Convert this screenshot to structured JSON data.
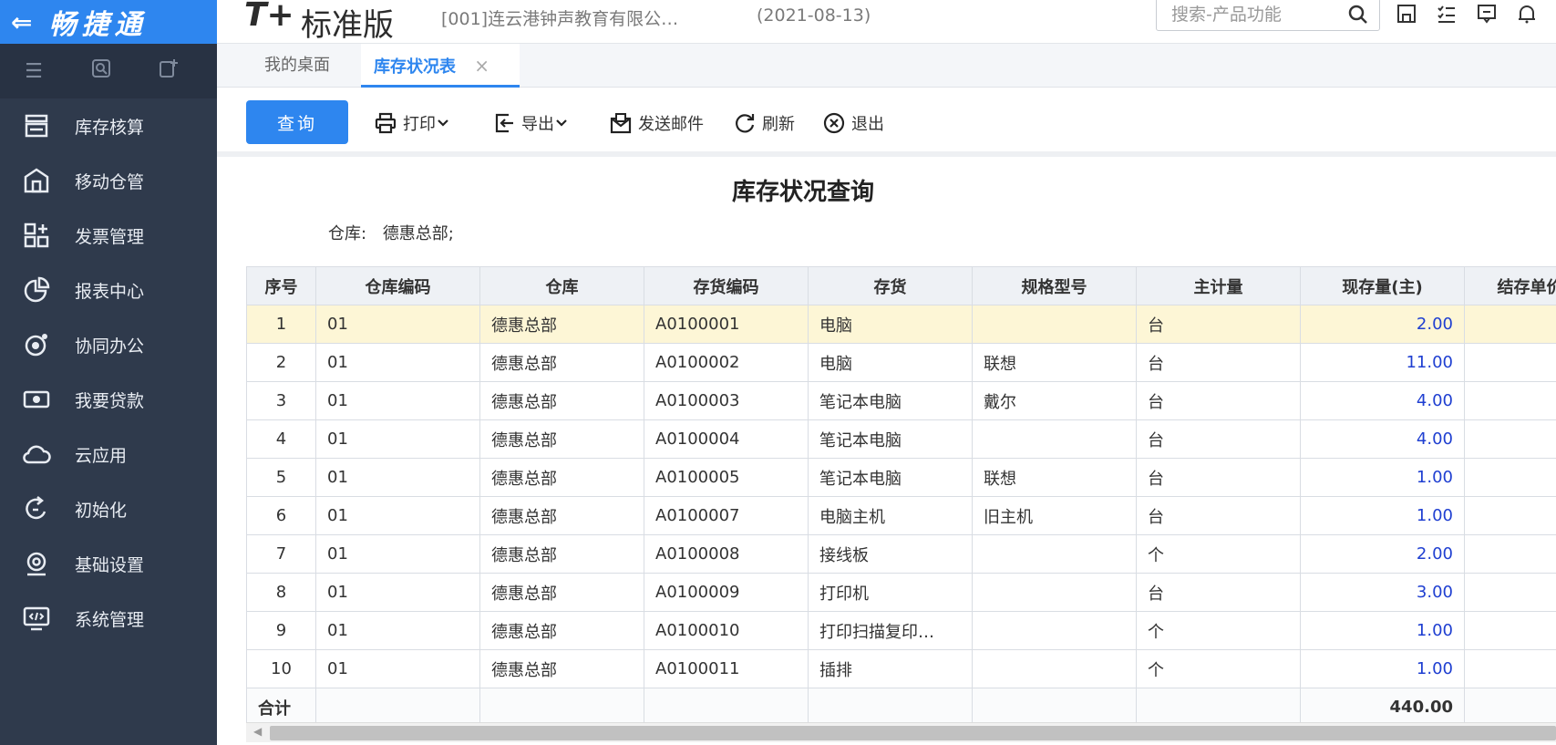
{
  "brand": {
    "arrow": "⇐",
    "name": "畅捷通"
  },
  "header": {
    "logo": "T+",
    "product": "标准版",
    "company": "[001]连云港钟声教育有限公…",
    "date": "(2021-08-13)",
    "search_placeholder": "搜索-产品功能"
  },
  "sidebar": {
    "items": [
      {
        "label": "库存核算",
        "icon": "inventory-icon"
      },
      {
        "label": "移动仓管",
        "icon": "mobile-warehouse-icon"
      },
      {
        "label": "发票管理",
        "icon": "invoice-icon"
      },
      {
        "label": "报表中心",
        "icon": "report-icon"
      },
      {
        "label": "协同办公",
        "icon": "collaboration-icon"
      },
      {
        "label": "我要贷款",
        "icon": "loan-icon"
      },
      {
        "label": "云应用",
        "icon": "cloud-icon"
      },
      {
        "label": "初始化",
        "icon": "initialize-icon"
      },
      {
        "label": "基础设置",
        "icon": "settings-icon"
      },
      {
        "label": "系统管理",
        "icon": "system-icon"
      }
    ]
  },
  "tabs": {
    "home": "我的桌面",
    "active": "库存状况表",
    "close": "×"
  },
  "toolbar": {
    "query": "查询",
    "print": "打印",
    "export": "导出",
    "mail": "发送邮件",
    "refresh": "刷新",
    "exit": "退出"
  },
  "report": {
    "title": "库存状况查询",
    "filter_label": "仓库:",
    "filter_value": "德惠总部;"
  },
  "table": {
    "headers": [
      "序号",
      "仓库编码",
      "仓库",
      "存货编码",
      "存货",
      "规格型号",
      "主计量",
      "现存量(主)",
      "结存单价"
    ],
    "rows": [
      {
        "no": "1",
        "wh_code": "01",
        "wh": "德惠总部",
        "code": "A0100001",
        "item": "电脑",
        "spec": "",
        "unit": "台",
        "qty": "2.00"
      },
      {
        "no": "2",
        "wh_code": "01",
        "wh": "德惠总部",
        "code": "A0100002",
        "item": "电脑",
        "spec": "联想",
        "unit": "台",
        "qty": "11.00"
      },
      {
        "no": "3",
        "wh_code": "01",
        "wh": "德惠总部",
        "code": "A0100003",
        "item": "笔记本电脑",
        "spec": "戴尔",
        "unit": "台",
        "qty": "4.00"
      },
      {
        "no": "4",
        "wh_code": "01",
        "wh": "德惠总部",
        "code": "A0100004",
        "item": "笔记本电脑",
        "spec": "",
        "unit": "台",
        "qty": "4.00"
      },
      {
        "no": "5",
        "wh_code": "01",
        "wh": "德惠总部",
        "code": "A0100005",
        "item": "笔记本电脑",
        "spec": "联想",
        "unit": "台",
        "qty": "1.00"
      },
      {
        "no": "6",
        "wh_code": "01",
        "wh": "德惠总部",
        "code": "A0100007",
        "item": "电脑主机",
        "spec": "旧主机",
        "unit": "台",
        "qty": "1.00"
      },
      {
        "no": "7",
        "wh_code": "01",
        "wh": "德惠总部",
        "code": "A0100008",
        "item": "接线板",
        "spec": "",
        "unit": "个",
        "qty": "2.00"
      },
      {
        "no": "8",
        "wh_code": "01",
        "wh": "德惠总部",
        "code": "A0100009",
        "item": "打印机",
        "spec": "",
        "unit": "台",
        "qty": "3.00"
      },
      {
        "no": "9",
        "wh_code": "01",
        "wh": "德惠总部",
        "code": "A0100010",
        "item": "打印扫描复印…",
        "spec": "",
        "unit": "个",
        "qty": "1.00"
      },
      {
        "no": "10",
        "wh_code": "01",
        "wh": "德惠总部",
        "code": "A0100011",
        "item": "插排",
        "spec": "",
        "unit": "个",
        "qty": "1.00"
      }
    ],
    "total_label": "合计",
    "total_qty": "440.00"
  }
}
